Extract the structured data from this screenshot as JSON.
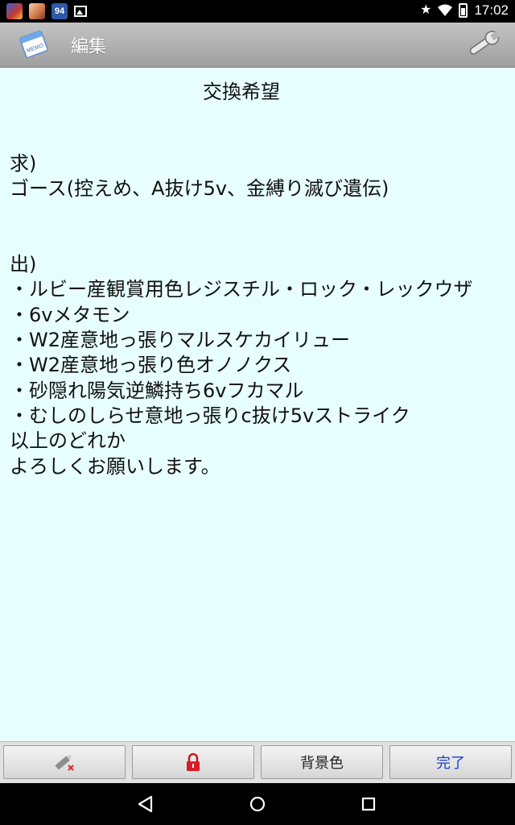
{
  "status_bar": {
    "notification_icons": [
      "game-app-icon",
      "character-app-icon",
      "app-94-icon",
      "image-icon"
    ],
    "thumb3_label": "94",
    "time": "17:02",
    "system_icons": [
      "star-icon",
      "wifi-icon",
      "battery-icon"
    ]
  },
  "action_bar": {
    "app_icon": "memo-icon",
    "title": "編集",
    "settings_icon": "wrench-icon"
  },
  "memo": {
    "title": "交換希望",
    "body": "求)\nゴース(控えめ、A抜け5v、金縛り滅び遺伝)\n\n\n出)\n・ルビー産観賞用色レジスチル・ロック・レックウザ\n・6vメタモン\n・W2産意地っ張りマルスケカイリュー\n・W2産意地っ張り色オノノクス\n・砂隠れ陽気逆鱗持ち6vフカマル\n・むしのしらせ意地っ張りc抜け5vストライク\n以上のどれか\nよろしくお願いします。",
    "background_color": "#e8ffff"
  },
  "toolbar": {
    "erase_icon": "pencil-erase-icon",
    "lock_icon": "lock-icon",
    "bg_color_label": "背景色",
    "done_label": "完了"
  },
  "nav_bar": {
    "buttons": [
      "back-icon",
      "home-icon",
      "recents-icon"
    ]
  }
}
